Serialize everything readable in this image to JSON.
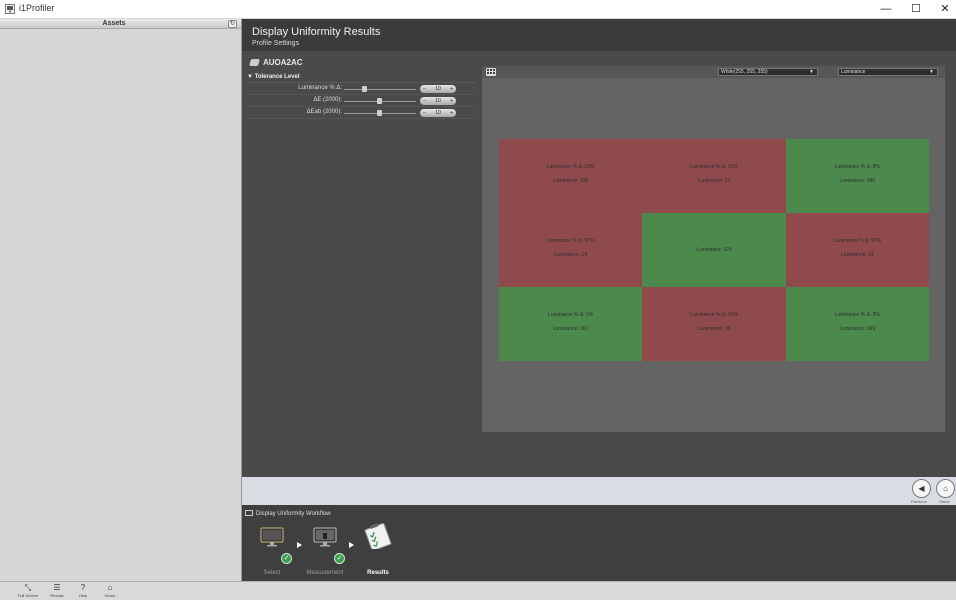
{
  "window": {
    "title": "i1Profiler",
    "minimize": "—",
    "maximize": "☐",
    "close": "✕"
  },
  "assets": {
    "header": "Assets",
    "refresh": "↻"
  },
  "main": {
    "title": "Display Uniformity Results",
    "subtitle": "Profile Settings",
    "device": "AUOA2AC"
  },
  "tolerance": {
    "header": "Tolerance Level",
    "rows": [
      {
        "label": "Luminance % Δ:",
        "value": "10",
        "level": 0.25
      },
      {
        "label": "ΔE (2000):",
        "value": "10",
        "level": 0.45
      },
      {
        "label": "ΔEab (2000):",
        "value": "10",
        "level": 0.45
      }
    ]
  },
  "panel": {
    "patch_dropdown": "White(255, 255, 255)",
    "metric_dropdown": "Luminance",
    "cells": [
      {
        "status": "fail",
        "line1": "Luminance % Δ: 10%",
        "line2": "Luminance: 330"
      },
      {
        "status": "fail",
        "line1": "Luminance % Δ: 93%",
        "line2": "Luminance: 22"
      },
      {
        "status": "pass",
        "line1": "Luminance % Δ: 8%",
        "line2": "Luminance: 340"
      },
      {
        "status": "fail",
        "line1": "Luminance % Δ: 97%",
        "line2": "Luminance: 14"
      },
      {
        "status": "pass",
        "line1": "Luminance: 324",
        "line2": ""
      },
      {
        "status": "fail",
        "line1": "Luminance % Δ: 97%",
        "line2": "Luminance: 14"
      },
      {
        "status": "pass",
        "line1": "Luminance % Δ: 1%",
        "line2": "Luminance: 361"
      },
      {
        "status": "fail",
        "line1": "Luminance % Δ: 93%",
        "line2": "Luminance: 26"
      },
      {
        "status": "pass",
        "line1": "Luminance % Δ: 3%",
        "line2": "Luminance: 369"
      }
    ],
    "colors": {
      "fail": "#8f4a4d",
      "pass": "#4b8a4c"
    }
  },
  "nav": {
    "previous": "Previous",
    "home": "Home",
    "previous_icon": "◀",
    "home_icon": "⌂"
  },
  "workflow": {
    "title": "Display Uniformity Workflow",
    "steps": [
      {
        "label": "Select",
        "done": true
      },
      {
        "label": "Measurement",
        "done": true
      },
      {
        "label": "Results",
        "done": false,
        "active": true
      }
    ],
    "check": "✓"
  },
  "toolbar": {
    "items": [
      {
        "label": "Full Screen",
        "icon": "⤡"
      },
      {
        "label": "Results",
        "icon": "☰"
      },
      {
        "label": "Help",
        "icon": "?"
      },
      {
        "label": "Home",
        "icon": "⌂"
      }
    ]
  }
}
